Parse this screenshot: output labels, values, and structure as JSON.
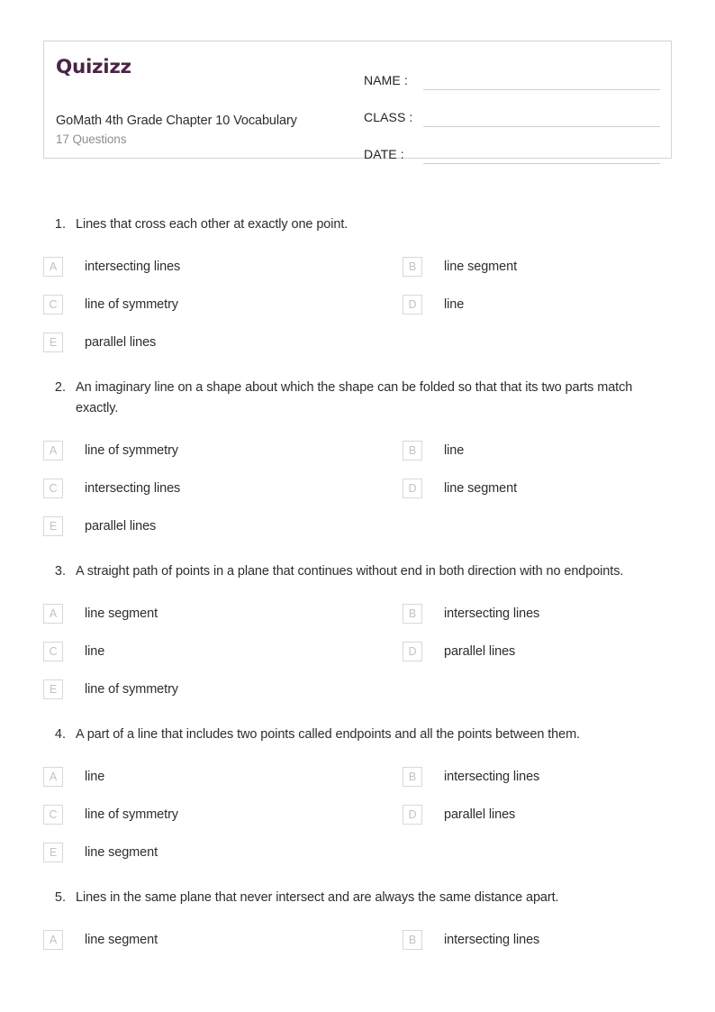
{
  "brand": {
    "logo_text": "Quizizz",
    "logo_color": "#4a2545"
  },
  "header": {
    "title": "GoMath 4th Grade Chapter 10 Vocabulary",
    "question_count_label": "17 Questions",
    "fields": [
      {
        "label": "NAME :",
        "value": ""
      },
      {
        "label": "CLASS :",
        "value": ""
      },
      {
        "label": "DATE  :",
        "value": ""
      }
    ]
  },
  "questions": [
    {
      "number": "1.",
      "text": "Lines that cross each other at exactly one point.",
      "options": [
        {
          "letter": "A",
          "text": "intersecting lines"
        },
        {
          "letter": "B",
          "text": "line segment"
        },
        {
          "letter": "C",
          "text": "line of symmetry"
        },
        {
          "letter": "D",
          "text": "line"
        },
        {
          "letter": "E",
          "text": "parallel lines"
        }
      ]
    },
    {
      "number": "2.",
      "text": "An imaginary line on a shape about which the shape can be folded so that that its two parts match exactly.",
      "options": [
        {
          "letter": "A",
          "text": "line of symmetry"
        },
        {
          "letter": "B",
          "text": "line"
        },
        {
          "letter": "C",
          "text": "intersecting lines"
        },
        {
          "letter": "D",
          "text": "line segment"
        },
        {
          "letter": "E",
          "text": "parallel lines"
        }
      ]
    },
    {
      "number": "3.",
      "text": "A straight path of points in a plane that continues without end in both direction with no endpoints.",
      "options": [
        {
          "letter": "A",
          "text": "line segment"
        },
        {
          "letter": "B",
          "text": "intersecting lines"
        },
        {
          "letter": "C",
          "text": "line"
        },
        {
          "letter": "D",
          "text": "parallel lines"
        },
        {
          "letter": "E",
          "text": "line of symmetry"
        }
      ]
    },
    {
      "number": "4.",
      "text": "A part of a line that includes two points called endpoints and all the points between them.",
      "options": [
        {
          "letter": "A",
          "text": "line"
        },
        {
          "letter": "B",
          "text": "intersecting lines"
        },
        {
          "letter": "C",
          "text": "line of symmetry"
        },
        {
          "letter": "D",
          "text": "parallel lines"
        },
        {
          "letter": "E",
          "text": "line segment"
        }
      ]
    },
    {
      "number": "5.",
      "text": "Lines in the same plane that never intersect and are always the same distance apart.",
      "options": [
        {
          "letter": "A",
          "text": "line segment"
        },
        {
          "letter": "B",
          "text": "intersecting lines"
        }
      ]
    }
  ]
}
